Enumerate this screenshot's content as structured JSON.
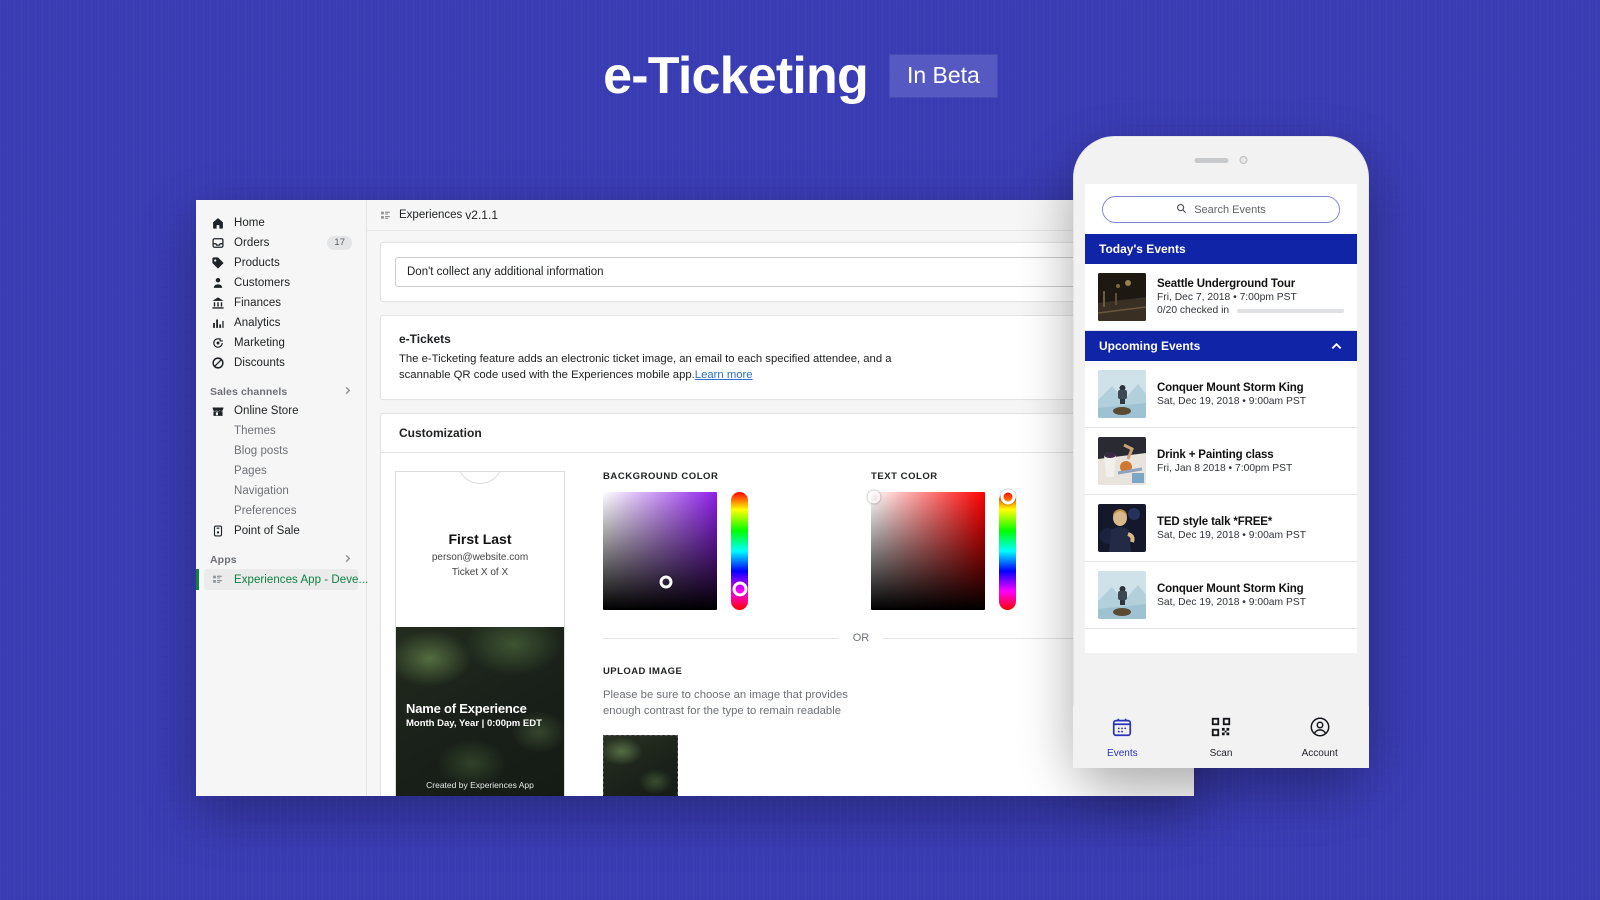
{
  "hero": {
    "title": "e-Ticketing",
    "badge": "In Beta"
  },
  "theme": {
    "page_background": "#3a3cb4",
    "badge_background": "#5659c2",
    "app_accent_green": "#108043",
    "phone_header_blue": "#1024a8",
    "active_tab_blue": "#2b32ba",
    "link_blue": "#2c6ecb"
  },
  "sidebar": {
    "items": [
      {
        "label": "Home",
        "icon": "home-icon",
        "badge": ""
      },
      {
        "label": "Orders",
        "icon": "orders-icon",
        "badge": "17"
      },
      {
        "label": "Products",
        "icon": "products-tag-icon",
        "badge": ""
      },
      {
        "label": "Customers",
        "icon": "customers-person-icon",
        "badge": ""
      },
      {
        "label": "Finances",
        "icon": "finances-bank-icon",
        "badge": ""
      },
      {
        "label": "Analytics",
        "icon": "analytics-bars-icon",
        "badge": ""
      },
      {
        "label": "Marketing",
        "icon": "marketing-target-icon",
        "badge": ""
      },
      {
        "label": "Discounts",
        "icon": "discounts-icon",
        "badge": ""
      }
    ],
    "sales_channels": {
      "title": "Sales channels",
      "chevron": "chevron-right-icon",
      "online_store": {
        "label": "Online Store",
        "icon": "store-icon"
      },
      "sub_items": [
        {
          "label": "Themes"
        },
        {
          "label": "Blog posts"
        },
        {
          "label": "Pages"
        },
        {
          "label": "Navigation"
        },
        {
          "label": "Preferences"
        }
      ],
      "point_of_sale": {
        "label": "Point of Sale",
        "icon": "pos-icon"
      }
    },
    "apps": {
      "title": "Apps",
      "chevron": "chevron-right-icon",
      "selected": {
        "label": "Experiences App - Deve...",
        "icon": "app-grid-icon"
      }
    }
  },
  "topbar": {
    "icon": "app-grid-icon",
    "title": "Experiences",
    "version": "v2.1.1"
  },
  "form": {
    "collect_select": {
      "value": "Don't collect any additional information",
      "placeholder": "Don't collect any additional information"
    }
  },
  "etickets": {
    "title": "e-Tickets",
    "description": "The e-Ticketing feature adds an electronic ticket image, an email to each specified attendee, and a scannable QR code used with the Experiences mobile app.",
    "learn_more": "Learn more"
  },
  "customization": {
    "heading": "Customization",
    "ticket_preview": {
      "name": "First Last",
      "email": "person@website.com",
      "ticket_count": "Ticket X of X",
      "experience_name": "Name of Experience",
      "experience_date": "Month Day, Year | 0:00pm EDT",
      "credit": "Created by Experiences App"
    },
    "background_color": {
      "label": "BACKGROUND COLOR",
      "value": "#6b3fa0"
    },
    "text_color": {
      "label": "TEXT COLOR",
      "value": "#c41818"
    },
    "or_label": "OR",
    "upload": {
      "label": "UPLOAD IMAGE",
      "description": "Please be sure to choose an image that provides enough contrast for the type to remain readable"
    }
  },
  "phone": {
    "search": {
      "placeholder": "Search Events",
      "icon": "search-icon"
    },
    "sections": [
      {
        "title": "Today's Events",
        "chevron": "",
        "events": [
          {
            "title": "Seattle Underground Tour",
            "meta": "Fri, Dec 7, 2018  •  7:00pm PST",
            "checked_in": "0/20 checked in",
            "thumb": "underground-tunnel-photo"
          }
        ]
      },
      {
        "title": "Upcoming Events",
        "chevron": "chevron-up-icon",
        "events": [
          {
            "title": "Conquer Mount Storm King",
            "meta": "Sat, Dec 19, 2018  •  9:00am PST",
            "checked_in": "",
            "thumb": "hiker-mountain-photo"
          },
          {
            "title": "Drink + Painting class",
            "meta": "Fri, Jan 8 2018  •  7:00pm PST",
            "checked_in": "",
            "thumb": "painting-class-photo"
          },
          {
            "title": "TED style talk *FREE*",
            "meta": "Sat, Dec 19, 2018  •  9:00am PST",
            "checked_in": "",
            "thumb": "speaker-stage-photo"
          },
          {
            "title": "Conquer Mount Storm King",
            "meta": "Sat, Dec 19, 2018  •  9:00am PST",
            "checked_in": "",
            "thumb": "hiker-mountain-photo"
          }
        ]
      }
    ],
    "tabs": [
      {
        "label": "Events",
        "icon": "calendar-icon",
        "active": true
      },
      {
        "label": "Scan",
        "icon": "qr-code-icon",
        "active": false
      },
      {
        "label": "Account",
        "icon": "account-person-icon",
        "active": false
      }
    ]
  }
}
